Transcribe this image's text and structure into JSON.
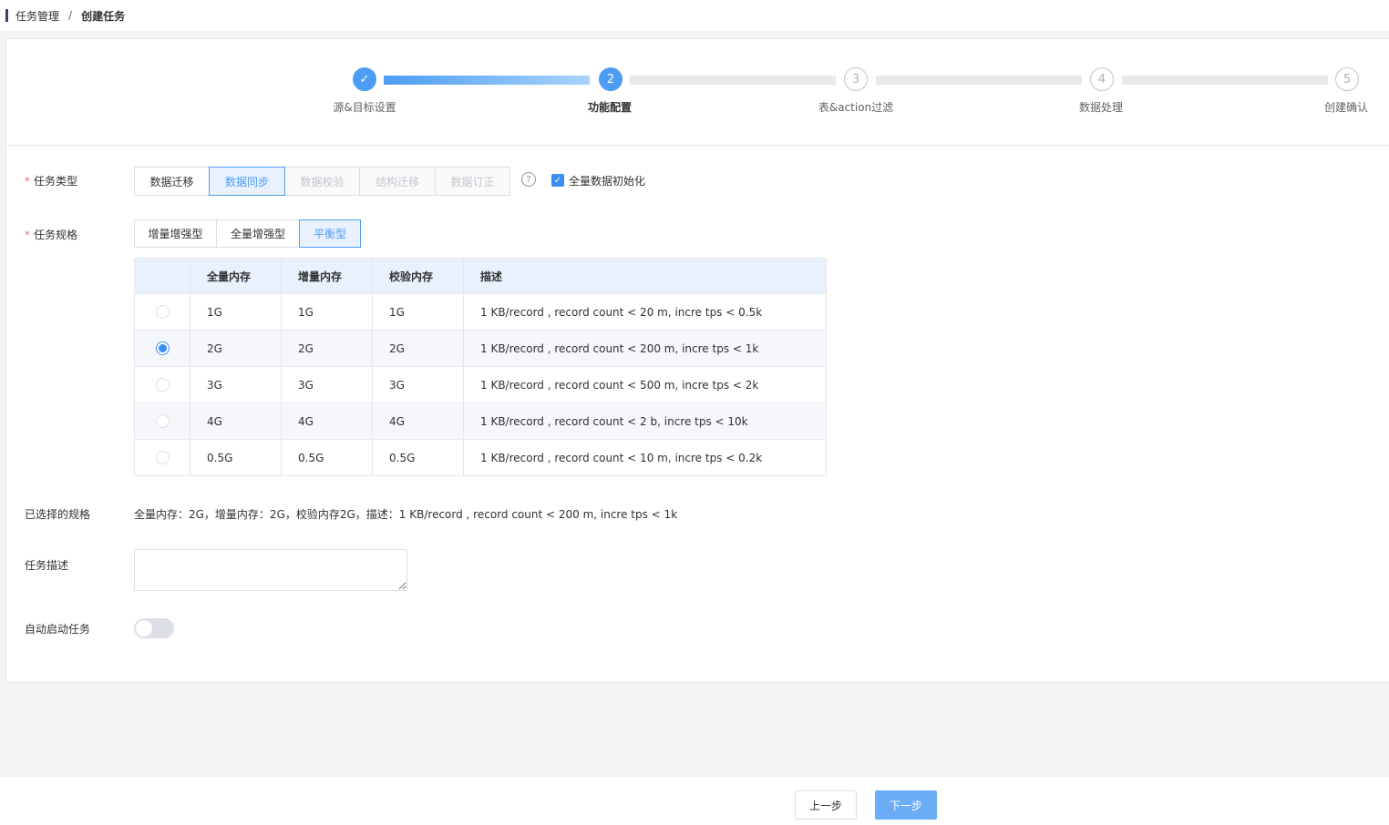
{
  "breadcrumb": {
    "items": [
      "任务管理",
      "创建任务"
    ],
    "separator": "/"
  },
  "steps": [
    {
      "number": "✓",
      "label": "源&目标设置",
      "status": "done"
    },
    {
      "number": "2",
      "label": "功能配置",
      "status": "active"
    },
    {
      "number": "3",
      "label": "表&action过滤",
      "status": "pending"
    },
    {
      "number": "4",
      "label": "数据处理",
      "status": "pending"
    },
    {
      "number": "5",
      "label": "创建确认",
      "status": "pending"
    }
  ],
  "task_type": {
    "label": "任务类型",
    "options": [
      "数据迁移",
      "数据同步",
      "数据校验",
      "结构迁移",
      "数据订正"
    ],
    "selected": "数据同步",
    "help_icon": "?",
    "full_init_checkbox": {
      "label": "全量数据初始化",
      "checked": true
    }
  },
  "task_spec": {
    "label": "任务规格",
    "options": [
      "增量增强型",
      "全量增强型",
      "平衡型"
    ],
    "selected": "平衡型",
    "table": {
      "headers": [
        "",
        "全量内存",
        "增量内存",
        "校验内存",
        "描述"
      ],
      "rows": [
        {
          "full": "1G",
          "incr": "1G",
          "check": "1G",
          "desc": "1 KB/record , record count < 20 m, incre tps < 0.5k",
          "selected": false
        },
        {
          "full": "2G",
          "incr": "2G",
          "check": "2G",
          "desc": "1 KB/record , record count < 200 m, incre tps < 1k",
          "selected": true
        },
        {
          "full": "3G",
          "incr": "3G",
          "check": "3G",
          "desc": "1 KB/record , record count < 500 m, incre tps < 2k",
          "selected": false
        },
        {
          "full": "4G",
          "incr": "4G",
          "check": "4G",
          "desc": "1 KB/record , record count < 2 b, incre tps < 10k",
          "selected": false
        },
        {
          "full": "0.5G",
          "incr": "0.5G",
          "check": "0.5G",
          "desc": "1 KB/record , record count < 10 m, incre tps < 0.2k",
          "selected": false
        }
      ]
    }
  },
  "selected_spec": {
    "label": "已选择的规格",
    "text": "全量内存：2G，增量内存：2G，校验内存2G，描述：1 KB/record , record count < 200 m, incre tps < 1k"
  },
  "task_desc": {
    "label": "任务描述",
    "value": ""
  },
  "auto_start": {
    "label": "自动启动任务",
    "on": false
  },
  "footer": {
    "prev_label": "上一步",
    "next_label": "下一步"
  },
  "colors": {
    "primary": "#4d9df4",
    "required": "#f56c6c"
  }
}
